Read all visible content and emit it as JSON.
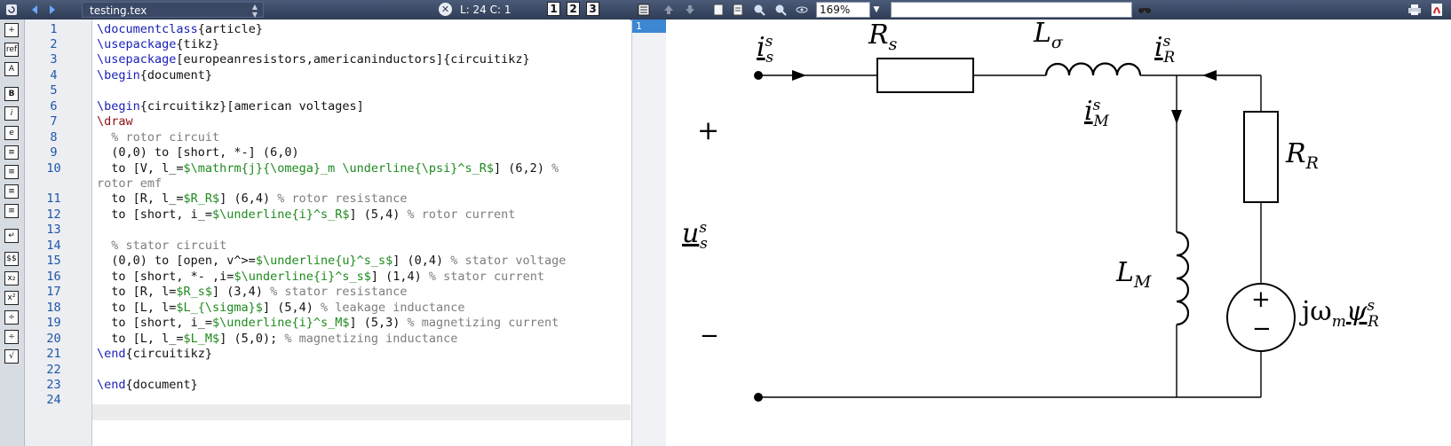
{
  "toolbar": {
    "file_tab": "testing.tex",
    "cursor_position": "L: 24 C: 1",
    "page_buttons": [
      "1",
      "2",
      "3"
    ],
    "zoom": "169%",
    "search_placeholder": "",
    "icons": [
      "refresh-icon",
      "back-icon",
      "forward-icon",
      "close-icon",
      "up-icon",
      "down-icon",
      "page-icon",
      "page-fit-icon",
      "zoom-in-icon",
      "zoom-out-icon",
      "fit-icon",
      "binoculars-icon",
      "print-icon",
      "pdf-icon"
    ]
  },
  "left_tools": [
    "+",
    "ref",
    "A",
    "B",
    "i",
    "e",
    "≡",
    "≡",
    "≡",
    "≡",
    "↵",
    "$$",
    "x₂",
    "x²",
    "÷",
    "÷",
    "√"
  ],
  "editor": {
    "line_numbers": [
      "1",
      "2",
      "3",
      "4",
      "5",
      "6",
      "7",
      "8",
      "9",
      "10",
      "",
      "11",
      "12",
      "13",
      "14",
      "15",
      "16",
      "17",
      "18",
      "19",
      "20",
      "21",
      "22",
      "23",
      "24"
    ],
    "current_line": "24"
  },
  "pages_panel": {
    "page": "1"
  },
  "circuit_labels": {
    "Rs": "R",
    "Rs_sub": "s",
    "Lsigma": "L",
    "Lsigma_sub": "σ",
    "is": "i",
    "is_sup": "s",
    "is_sub": "s",
    "iR": "i",
    "iR_sup": "s",
    "iR_sub": "R",
    "iM": "i",
    "iM_sup": "s",
    "iM_sub": "M",
    "RR": "R",
    "RR_sub": "R",
    "LM": "L",
    "LM_sub": "M",
    "us": "u",
    "us_sup": "s",
    "us_sub": "s",
    "emf_j": "jω",
    "emf_m": "m",
    "emf_psi": "ψ",
    "emf_sup": "s",
    "emf_sub": "R",
    "plus": "+",
    "minus": "−",
    "src_plus": "+",
    "src_minus": "−"
  }
}
